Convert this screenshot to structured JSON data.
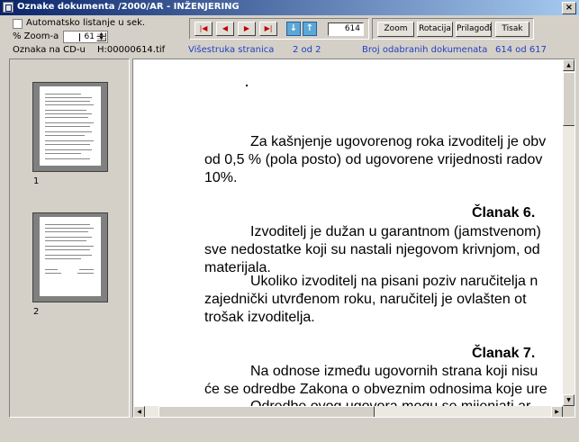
{
  "window": {
    "title": "Oznake dokumenta /2000/AR - INŽENJERING",
    "close_label": "×"
  },
  "options": {
    "auto_list_label": "Automatsko listanje u sek.",
    "zoom_label": "% Zoom-a",
    "zoom_value": "61"
  },
  "nav": {
    "page_value": "614"
  },
  "actions": {
    "zoom": "Zoom",
    "rotate": "Rotacija",
    "fit": "Prilagođi",
    "print": "Tisak"
  },
  "info": {
    "cd_label": "Oznaka na CD-u",
    "cd_value": "H:00000614.tif",
    "multipage_label": "Višestruka stranica",
    "multipage_value": "2 od 2",
    "selected_label": "Broj odabranih dokumenata",
    "selected_value": "614 od 617"
  },
  "thumbnails": [
    {
      "number": "1"
    },
    {
      "number": "2"
    }
  ],
  "document": {
    "lines": [
      "Za kašnjenje ugovorenog roka izvoditelj je obv",
      "od 0,5 % (pola posto) od ugovorene vrijednosti radov",
      "10%.",
      "Izvoditelj je dužan u garantnom (jamstvenom)",
      "sve nedostatke koji su nastali njegovom krivnjom, od",
      "materijala.",
      "Ukoliko izvoditelj na pisani poziv naručitelja n",
      "zajednički utvrđenom roku, naručitelj je ovlašten ot",
      "trošak izvoditelja.",
      "Na odnose između ugovornih strana koji nisu",
      "će se odredbe Zakona o obveznim odnosima koje ure",
      "Odredbe ovog ugovora mogu se mijenjati ar"
    ],
    "headings": [
      "Članak 6.",
      "Članak 7."
    ]
  }
}
